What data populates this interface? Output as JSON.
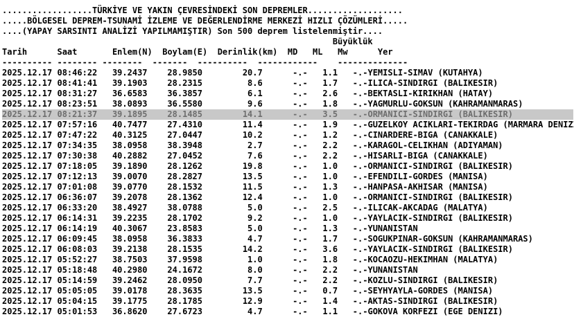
{
  "header": {
    "line1": "..................TÜRKİYE VE YAKIN ÇEVRESİNDEKİ SON DEPREMLER...................",
    "line2": ".....BÖLGESEL DEPREM-TSUNAMİ İZLEME VE DEĞERLENDİRME MERKEZİ HIZLI ÇÖZÜMLERİ.....",
    "line3": "....(YAPAY SARSINTI ANALİZİ YAPILMAMIŞTIR) Son 500 deprem listelenmiştir....",
    "magnitude_group": "Büyüklük"
  },
  "columns": {
    "date": "Tarih",
    "time": "Saat",
    "lat": "Enlem(N)",
    "lon": "Boylam(E)",
    "depth": "Derinlik(km)",
    "md": "MD",
    "ml": "ML",
    "mw": "Mw",
    "place": "Yer"
  },
  "separator": "---------- -------- --------  -------  ----------  ------------    --------------",
  "colors": {
    "text": "#000000",
    "highlight_bg": "#c8c8c8",
    "highlight_text": "#6e6e6e"
  },
  "highlighted_row": 4,
  "rows": [
    {
      "date": "2025.12.17",
      "time": "08:46:22",
      "lat": "39.2437",
      "lon": "28.9850",
      "depth": "20.7",
      "md": "-.-",
      "ml": "1.1",
      "mw": "-.-",
      "place": "YEMISLI-SIMAV (KUTAHYA)"
    },
    {
      "date": "2025.12.17",
      "time": "08:41:41",
      "lat": "39.1903",
      "lon": "28.2315",
      "depth": "8.6",
      "md": "-.-",
      "ml": "1.7",
      "mw": "-.-",
      "place": "ILICA-SINDIRGI (BALIKESIR)"
    },
    {
      "date": "2025.12.17",
      "time": "08:31:27",
      "lat": "36.6583",
      "lon": "36.3857",
      "depth": "6.1",
      "md": "-.-",
      "ml": "2.6",
      "mw": "-.-",
      "place": "BEKTASLI-KIRIKHAN (HATAY)"
    },
    {
      "date": "2025.12.17",
      "time": "08:23:51",
      "lat": "38.0893",
      "lon": "36.5580",
      "depth": "9.6",
      "md": "-.-",
      "ml": "1.8",
      "mw": "-.-",
      "place": "YAGMURLU-GOKSUN (KAHRAMANMARAS)"
    },
    {
      "date": "2025.12.17",
      "time": "08:21:37",
      "lat": "39.1895",
      "lon": "28.1485",
      "depth": "14.1",
      "md": "-.-",
      "ml": "3.5",
      "mw": "-.-",
      "place": "ORMANICI-SINDIRGI (BALIKESIR)"
    },
    {
      "date": "2025.12.17",
      "time": "07:57:16",
      "lat": "40.7477",
      "lon": "27.4310",
      "depth": "11.4",
      "md": "-.-",
      "ml": "1.9",
      "mw": "-.-",
      "place": "GUZELKOY ACIKLARI-TEKIRDAG (MARMARA DENIZI)"
    },
    {
      "date": "2025.12.17",
      "time": "07:47:22",
      "lat": "40.3125",
      "lon": "27.0447",
      "depth": "10.2",
      "md": "-.-",
      "ml": "1.2",
      "mw": "-.-",
      "place": "CINARDERE-BIGA (CANAKKALE)"
    },
    {
      "date": "2025.12.17",
      "time": "07:34:35",
      "lat": "38.0958",
      "lon": "38.3948",
      "depth": "2.7",
      "md": "-.-",
      "ml": "2.2",
      "mw": "-.-",
      "place": "KARAGOL-CELIKHAN (ADIYAMAN)"
    },
    {
      "date": "2025.12.17",
      "time": "07:30:38",
      "lat": "40.2882",
      "lon": "27.0452",
      "depth": "7.6",
      "md": "-.-",
      "ml": "2.2",
      "mw": "-.-",
      "place": "HISARLI-BIGA (CANAKKALE)"
    },
    {
      "date": "2025.12.17",
      "time": "07:18:05",
      "lat": "39.1890",
      "lon": "28.1262",
      "depth": "19.8",
      "md": "-.-",
      "ml": "1.0",
      "mw": "-.-",
      "place": "ORMANICI-SINDIRGI (BALIKESIR)"
    },
    {
      "date": "2025.12.17",
      "time": "07:12:13",
      "lat": "39.0070",
      "lon": "28.2827",
      "depth": "13.5",
      "md": "-.-",
      "ml": "1.0",
      "mw": "-.-",
      "place": "EFENDILI-GORDES (MANISA)"
    },
    {
      "date": "2025.12.17",
      "time": "07:01:08",
      "lat": "39.0770",
      "lon": "28.1532",
      "depth": "11.5",
      "md": "-.-",
      "ml": "1.3",
      "mw": "-.-",
      "place": "HANPASA-AKHISAR (MANISA)"
    },
    {
      "date": "2025.12.17",
      "time": "06:36:07",
      "lat": "39.2078",
      "lon": "28.1362",
      "depth": "12.4",
      "md": "-.-",
      "ml": "1.0",
      "mw": "-.-",
      "place": "ORMANICI-SINDIRGI (BALIKESIR)"
    },
    {
      "date": "2025.12.17",
      "time": "06:33:20",
      "lat": "38.4927",
      "lon": "38.0788",
      "depth": "5.0",
      "md": "-.-",
      "ml": "2.5",
      "mw": "-.-",
      "place": "ILICAK-AKCADAG (MALATYA)"
    },
    {
      "date": "2025.12.17",
      "time": "06:14:31",
      "lat": "39.2235",
      "lon": "28.1702",
      "depth": "9.2",
      "md": "-.-",
      "ml": "1.0",
      "mw": "-.-",
      "place": "YAYLACIK-SINDIRGI (BALIKESIR)"
    },
    {
      "date": "2025.12.17",
      "time": "06:14:19",
      "lat": "40.3067",
      "lon": "23.8583",
      "depth": "5.0",
      "md": "-.-",
      "ml": "1.3",
      "mw": "-.-",
      "place": "YUNANISTAN"
    },
    {
      "date": "2025.12.17",
      "time": "06:09:45",
      "lat": "38.0958",
      "lon": "36.3833",
      "depth": "4.7",
      "md": "-.-",
      "ml": "1.7",
      "mw": "-.-",
      "place": "SOGUKPINAR-GOKSUN (KAHRAMANMARAS)"
    },
    {
      "date": "2025.12.17",
      "time": "06:08:03",
      "lat": "39.2138",
      "lon": "28.1535",
      "depth": "14.2",
      "md": "-.-",
      "ml": "3.6",
      "mw": "-.-",
      "place": "YAYLACIK-SINDIRGI (BALIKESIR)"
    },
    {
      "date": "2025.12.17",
      "time": "05:52:27",
      "lat": "38.7503",
      "lon": "37.9598",
      "depth": "1.0",
      "md": "-.-",
      "ml": "1.8",
      "mw": "-.-",
      "place": "KOCAOZU-HEKIMHAN (MALATYA)"
    },
    {
      "date": "2025.12.17",
      "time": "05:18:48",
      "lat": "40.2980",
      "lon": "24.1672",
      "depth": "8.0",
      "md": "-.-",
      "ml": "2.2",
      "mw": "-.-",
      "place": "YUNANISTAN"
    },
    {
      "date": "2025.12.17",
      "time": "05:14:59",
      "lat": "39.2462",
      "lon": "28.0950",
      "depth": "7.7",
      "md": "-.-",
      "ml": "2.2",
      "mw": "-.-",
      "place": "KOZLU-SINDIRGI (BALIKESIR)"
    },
    {
      "date": "2025.12.17",
      "time": "05:05:05",
      "lat": "39.0178",
      "lon": "28.3635",
      "depth": "13.5",
      "md": "-.-",
      "ml": "0.7",
      "mw": "-.-",
      "place": "SEYHYAYLA-GORDES (MANISA)"
    },
    {
      "date": "2025.12.17",
      "time": "05:04:15",
      "lat": "39.1775",
      "lon": "28.1785",
      "depth": "12.9",
      "md": "-.-",
      "ml": "1.4",
      "mw": "-.-",
      "place": "AKTAS-SINDIRGI (BALIKESIR)"
    },
    {
      "date": "2025.12.17",
      "time": "05:01:53",
      "lat": "36.8620",
      "lon": "27.6723",
      "depth": "4.7",
      "md": "-.-",
      "ml": "1.1",
      "mw": "-.-",
      "place": "GOKOVA KORFEZI (EGE DENIZI)"
    }
  ]
}
